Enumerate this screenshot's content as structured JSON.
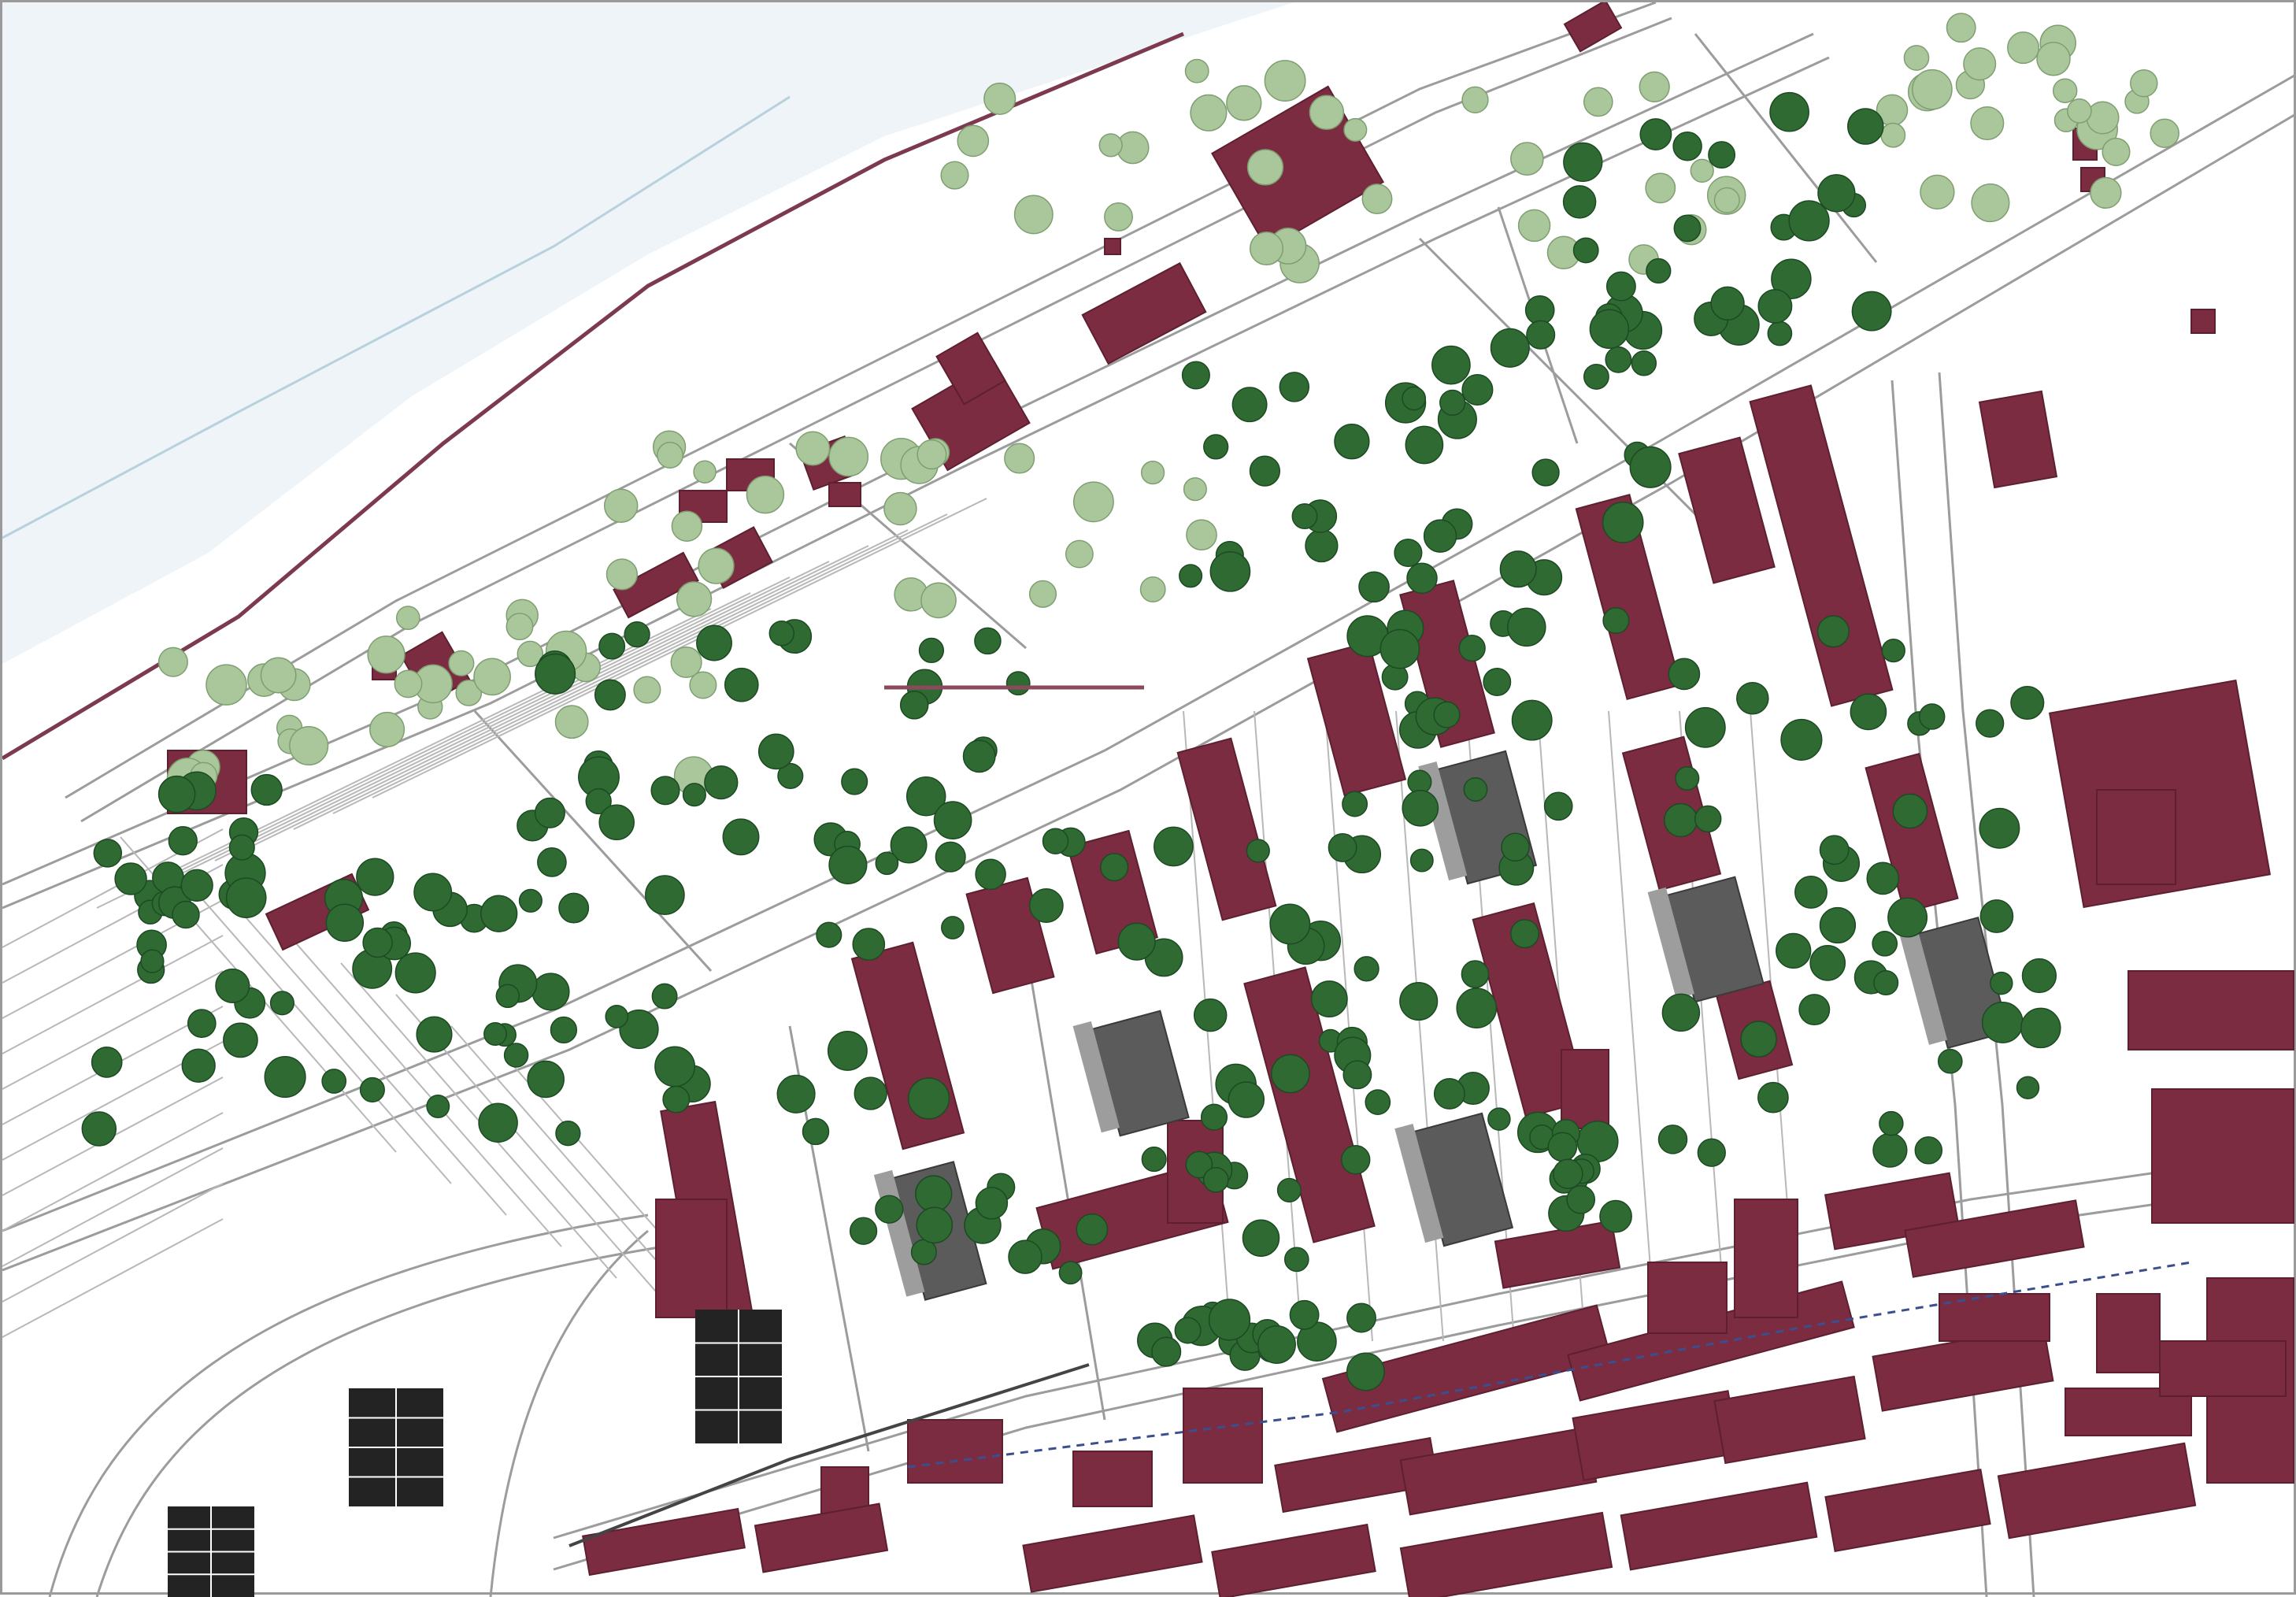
{
  "map": {
    "labels": [],
    "colors": {
      "background": "#ffffff",
      "frame": "#9a9a9a",
      "water": "#eef4f7",
      "shoreline": "#7d3a4e",
      "road_line": "#9c9c9c",
      "parcel_line": "#b8b8b8",
      "building": "#7b2c41",
      "building_outline": "#5e1f31",
      "new_building_dark": "#5b5b5b",
      "new_building_light": "#9d9d9d",
      "dark_block": "#232323",
      "tree_dark": "#2f6a33",
      "tree_light": "#a9c79a",
      "tree_outline": "#1c4a22",
      "rail_dash": "#3b4f8f"
    },
    "icons": [
      "tree-icon",
      "building-footprint"
    ]
  }
}
